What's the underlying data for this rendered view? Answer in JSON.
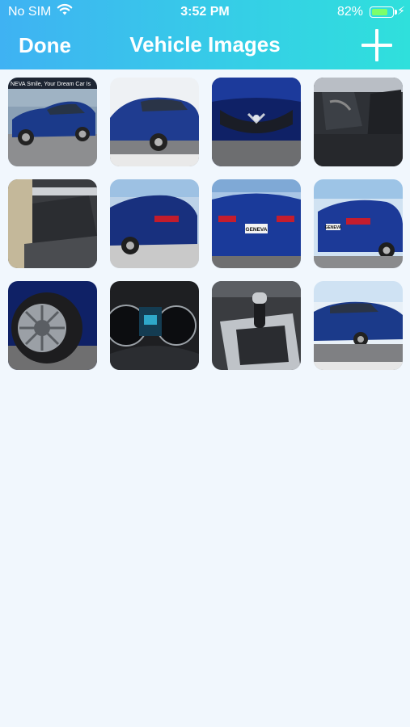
{
  "status_bar": {
    "carrier": "No SIM",
    "time": "3:52 PM",
    "battery_percent": "82%",
    "battery_level": 0.82,
    "icons": [
      "wifi-icon",
      "battery-icon",
      "charging-icon"
    ]
  },
  "nav": {
    "done_label": "Done",
    "title": "Vehicle Images",
    "add_icon": "plus-icon"
  },
  "colors": {
    "header_gradient": [
      "#3fb2f3",
      "#2fe0dc"
    ],
    "background": "#f1f7fd"
  },
  "images": [
    {
      "label": "NEVA  Smile, Your Dream Car Is"
    },
    {
      "label": ""
    },
    {
      "label": ""
    },
    {
      "label": ""
    },
    {
      "label": ""
    },
    {
      "label": ""
    },
    {
      "label": "GENEVA"
    },
    {
      "label": "GENEVA"
    },
    {
      "label": ""
    },
    {
      "label": ""
    },
    {
      "label": ""
    },
    {
      "label": ""
    }
  ]
}
